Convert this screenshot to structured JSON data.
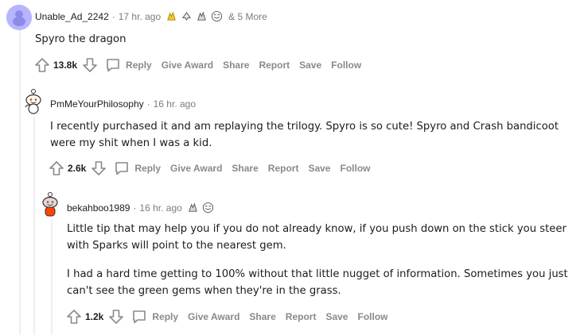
{
  "comments": [
    {
      "username": "Unable_Ad_2242",
      "time": "17 hr. ago",
      "more_awards": "& 5 More",
      "paragraphs": [
        "Spyro the dragon"
      ],
      "score": "13.8k"
    },
    {
      "username": "PmMeYourPhilosophy",
      "time": "16 hr. ago",
      "paragraphs": [
        "I recently purchased it and am replaying the trilogy. Spyro is so cute! Spyro and Crash bandicoot were my shit when I was a kid."
      ],
      "score": "2.6k"
    },
    {
      "username": "bekahboo1989",
      "time": "16 hr. ago",
      "paragraphs": [
        "Little tip that may help you if you do not already know, if you push down on the stick you steer with Sparks will point to the nearest gem.",
        "I had a hard time getting to 100% without that little nugget of information. Sometimes you just can't see the green gems when they're in the grass."
      ],
      "score": "1.2k"
    }
  ],
  "actions": {
    "reply": "Reply",
    "give_award": "Give Award",
    "share": "Share",
    "report": "Report",
    "save": "Save",
    "follow": "Follow"
  },
  "separator": "·",
  "icons": {
    "upvote": "upvote-arrow-icon",
    "downvote": "downvote-arrow-icon",
    "reply": "speech-bubble-icon"
  },
  "colors": {
    "meta_text": "#7c7c7c",
    "action_text": "#878a8c",
    "thread_line": "#edeff1"
  }
}
